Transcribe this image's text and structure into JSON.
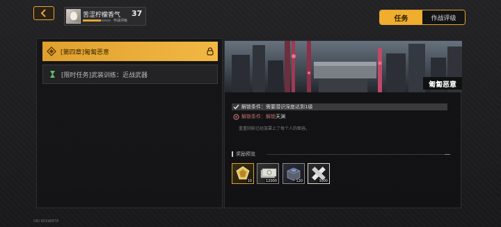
{
  "header": {
    "back_icon": "chevron-left-icon",
    "player": {
      "name": "苦涩柠檬香气",
      "level": "37",
      "exp_label": "作战评级",
      "exp_progress": 0.65
    }
  },
  "tabs": [
    {
      "label": "任务",
      "active": true
    },
    {
      "label": "作战评级",
      "active": false
    }
  ],
  "missions": [
    {
      "title": "[第四章]匍匐恶意",
      "selected": true,
      "icon": "diamond-quest-icon",
      "status_icon": "lock-icon"
    },
    {
      "title": "[限时任务]武装训练：近战武器",
      "selected": false,
      "icon": "green-quest-icon"
    }
  ],
  "detail": {
    "banner_title": "匍匐恶意",
    "requirements": [
      {
        "label": "解锁条件：",
        "text": "需要潜识深度达到1级",
        "met": true
      },
      {
        "label": "解锁条件：",
        "text_highlight": "解锁",
        "text": "天渊",
        "met": false
      }
    ],
    "description": "重重阴影已经笼罩上了每个人的面容。",
    "rewards_title": "奖励预览",
    "rewards": [
      {
        "count": "10",
        "rarity": "gold",
        "icon": "gold-chip-icon"
      },
      {
        "count": "12000",
        "rarity": "grey",
        "icon": "cash-bundle-icon"
      },
      {
        "count": "120",
        "rarity": "grey",
        "icon": "supply-box-icon"
      },
      {
        "count": "3000",
        "rarity": "white",
        "icon": "bandage-icon"
      }
    ]
  },
  "footer": {
    "uid": "UID 60198878"
  },
  "colors": {
    "accent": "#f0ae2e",
    "panel_bg": "#1c1c1e",
    "warning": "#c0706a"
  }
}
